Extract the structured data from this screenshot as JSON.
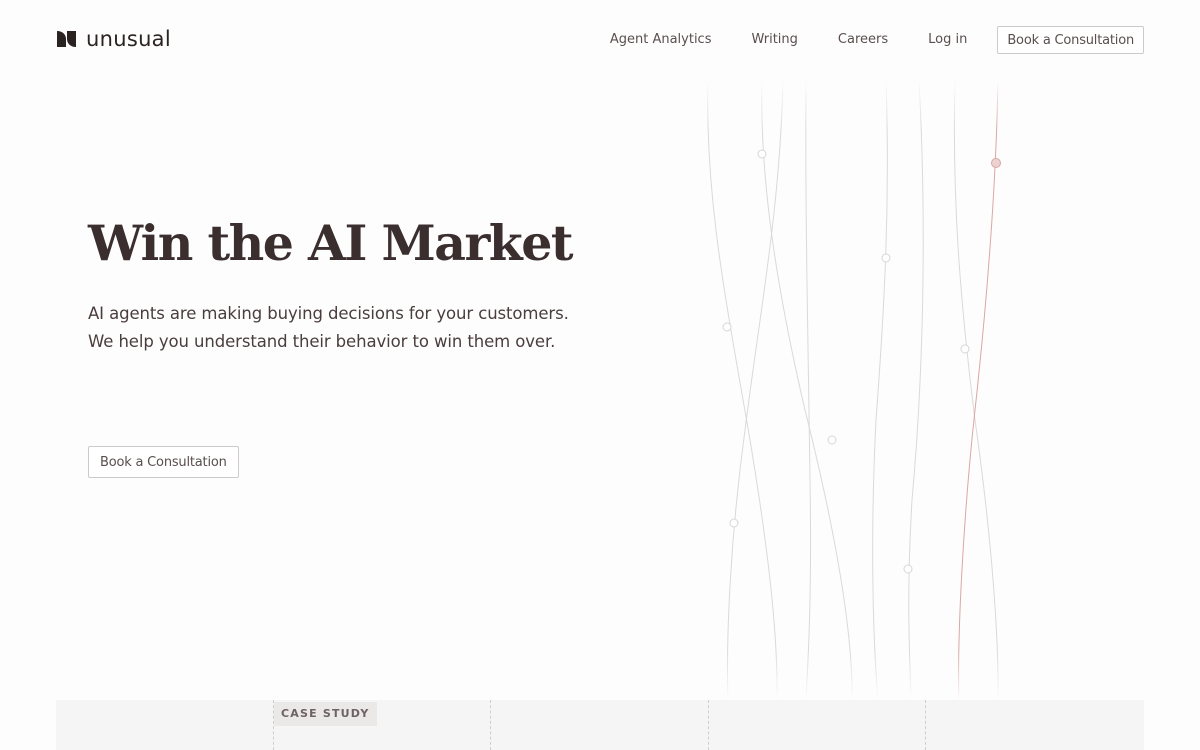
{
  "brand": {
    "name": "unusual",
    "logo_icon": "unusual-logo-mark"
  },
  "nav": {
    "items": [
      {
        "label": "Agent Analytics"
      },
      {
        "label": "Writing"
      },
      {
        "label": "Careers"
      },
      {
        "label": "Log in"
      }
    ],
    "cta_label": "Book a Consultation"
  },
  "hero": {
    "title": "Win the AI Market",
    "subtitle_lines": [
      "AI agents are making buying decisions for your customers.",
      "We help you understand their behavior to win them over."
    ],
    "cta_label": "Book a Consultation"
  },
  "case_study": {
    "tag": "CASE STUDY"
  },
  "colors": {
    "text": "#3b2e2e",
    "accent_line": "#d9a7a4",
    "neutral_line": "#dcd8d8",
    "strip_bg": "#f6f5f5"
  }
}
